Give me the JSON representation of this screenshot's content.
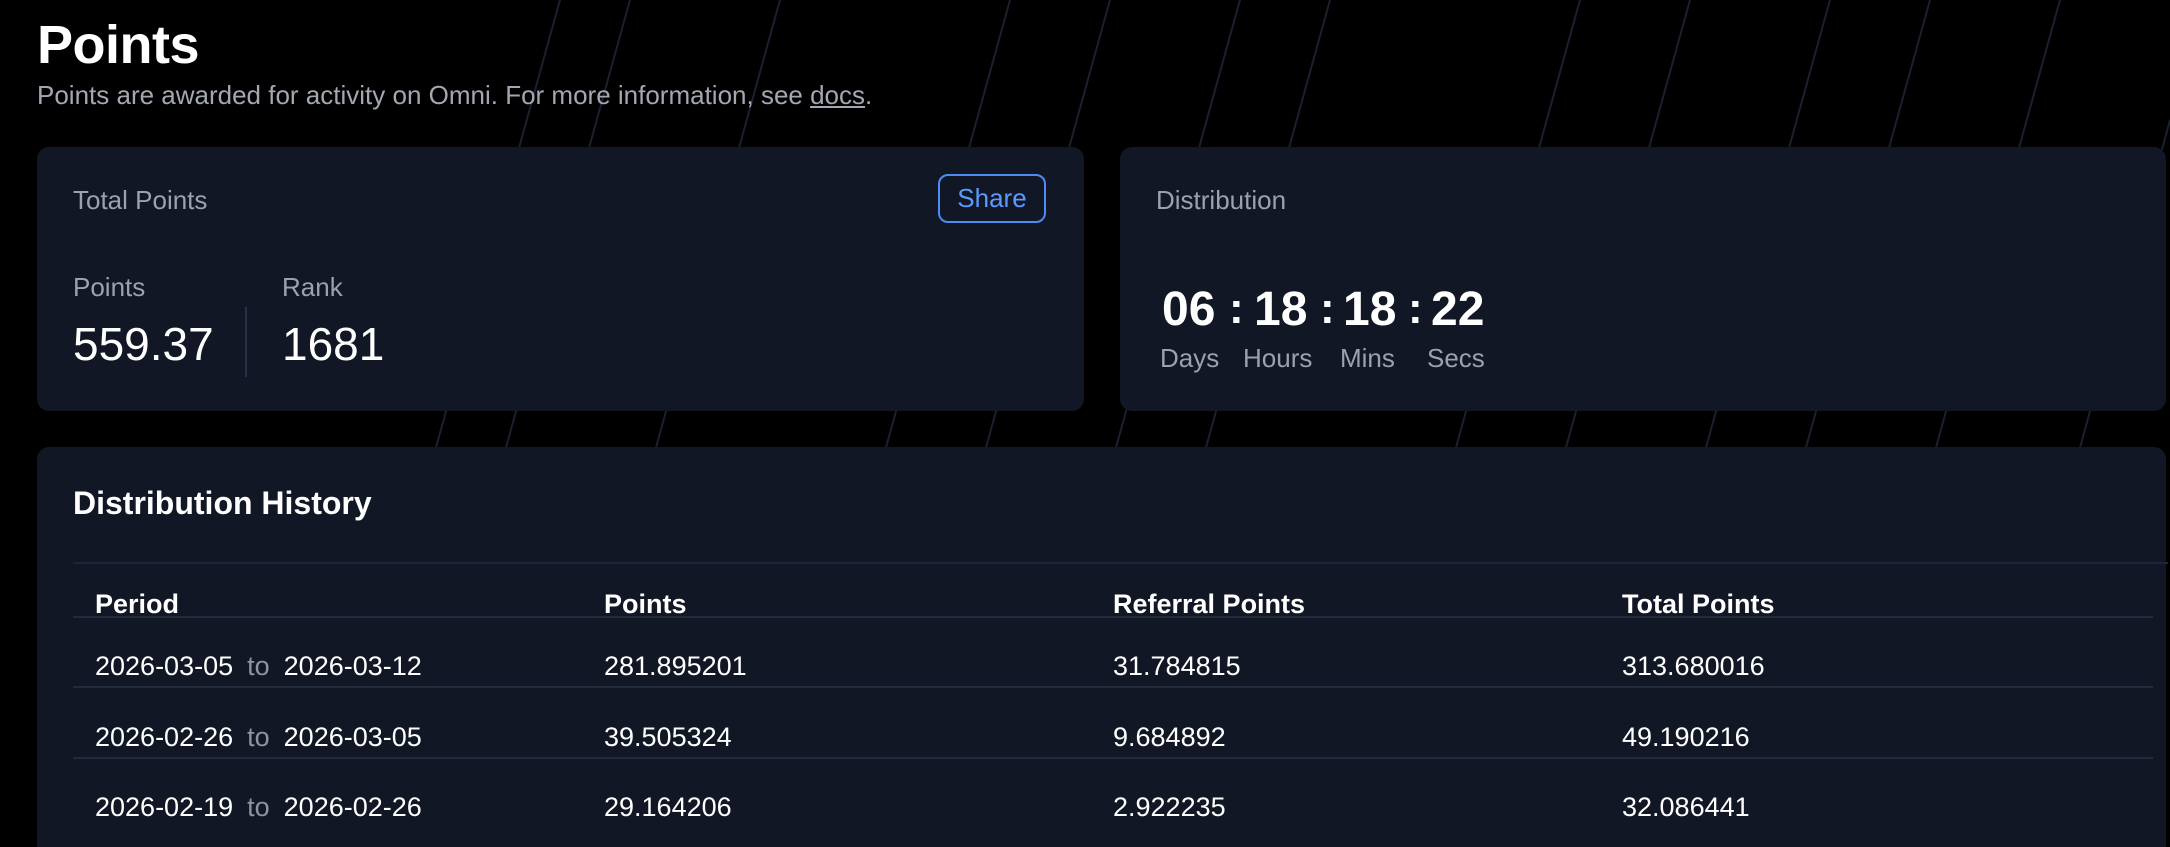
{
  "header": {
    "title": "Points",
    "subtitle_prefix": "Points are awarded for activity on Omni. For more information, see ",
    "docs_link": "docs",
    "subtitle_suffix": "."
  },
  "total_points": {
    "label": "Total Points",
    "share_label": "Share",
    "points_label": "Points",
    "points_value": "559.37",
    "rank_label": "Rank",
    "rank_value": "1681"
  },
  "distribution": {
    "label": "Distribution",
    "countdown": {
      "days": "06",
      "hours": "18",
      "mins": "18",
      "secs": "22",
      "separator": ":",
      "days_label": "Days",
      "hours_label": "Hours",
      "mins_label": "Mins",
      "secs_label": "Secs"
    }
  },
  "history": {
    "title": "Distribution History",
    "columns": [
      "Period",
      "Points",
      "Referral Points",
      "Total Points"
    ],
    "to_word": "to",
    "rows": [
      {
        "start": "2026-03-05",
        "end": "2026-03-12",
        "points": "281.895201",
        "referral": "31.784815",
        "total": "313.680016"
      },
      {
        "start": "2026-02-26",
        "end": "2026-03-05",
        "points": "39.505324",
        "referral": "9.684892",
        "total": "49.190216"
      },
      {
        "start": "2026-02-19",
        "end": "2026-02-26",
        "points": "29.164206",
        "referral": "2.922235",
        "total": "32.086441"
      }
    ]
  },
  "colors": {
    "background": "#000000",
    "card": "#121726",
    "accent": "#4b8cf5",
    "muted_text": "#9ca1ab"
  }
}
